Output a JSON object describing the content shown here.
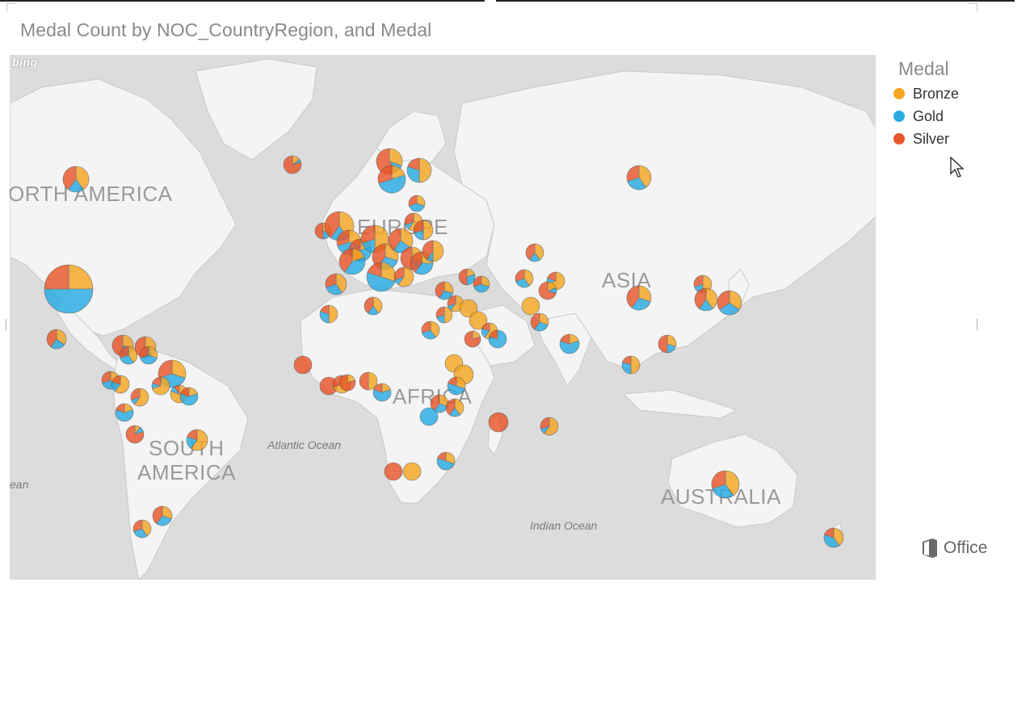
{
  "title": "Medal Count by NOC_CountryRegion, and Medal",
  "map_attribution": "bing",
  "legend": {
    "title": "Medal",
    "items": [
      {
        "label": "Bronze",
        "color": "#F5A623"
      },
      {
        "label": "Gold",
        "color": "#29ABE2"
      },
      {
        "label": "Silver",
        "color": "#E8562A"
      }
    ]
  },
  "labels": {
    "north_america": "ORTH AMERICA",
    "europe": "EUROPE",
    "asia": "ASIA",
    "africa": "AFRICA",
    "south_america_1": "SOUTH",
    "south_america_2": "AMERICA",
    "australia": "AUSTRALIA",
    "atlantic": "Atlantic Ocean",
    "indian": "Indian Ocean",
    "ocean_left": "ean"
  },
  "branding": "Office",
  "chart_data": {
    "type": "map",
    "measure": "Medal Count",
    "location_field": "NOC_CountryRegion",
    "series": [
      "Bronze",
      "Gold",
      "Silver"
    ],
    "colors": {
      "Bronze": "#F5A623",
      "Gold": "#29ABE2",
      "Silver": "#E8562A"
    }
  }
}
